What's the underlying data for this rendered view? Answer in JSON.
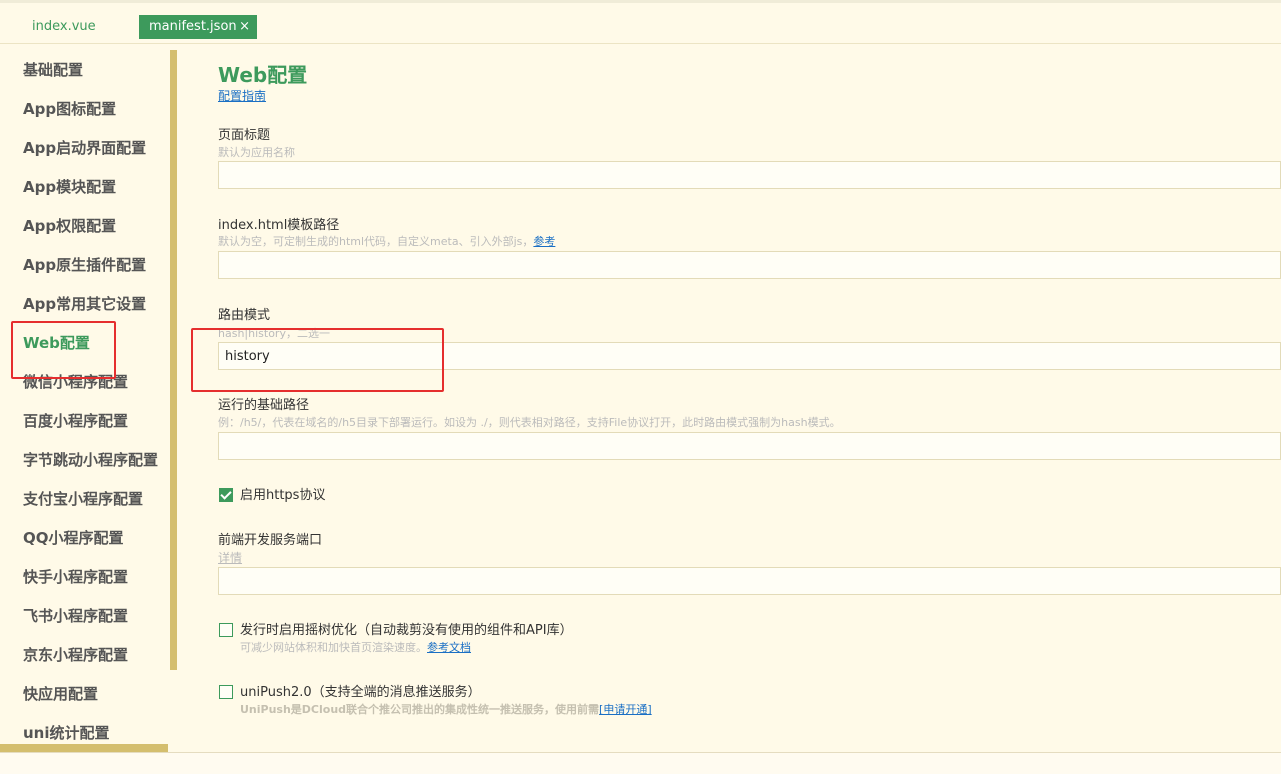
{
  "tabs": [
    {
      "label": "index.vue"
    },
    {
      "label": "manifest.json",
      "close": "×"
    }
  ],
  "sidebar": {
    "items": [
      {
        "label": "基础配置"
      },
      {
        "label": "App图标配置"
      },
      {
        "label": "App启动界面配置"
      },
      {
        "label": "App模块配置"
      },
      {
        "label": "App权限配置"
      },
      {
        "label": "App原生插件配置"
      },
      {
        "label": "App常用其它设置"
      },
      {
        "label": "Web配置"
      },
      {
        "label": "微信小程序配置"
      },
      {
        "label": "百度小程序配置"
      },
      {
        "label": "字节跳动小程序配置"
      },
      {
        "label": "支付宝小程序配置"
      },
      {
        "label": "QQ小程序配置"
      },
      {
        "label": "快手小程序配置"
      },
      {
        "label": "飞书小程序配置"
      },
      {
        "label": "京东小程序配置"
      },
      {
        "label": "快应用配置"
      },
      {
        "label": "uni统计配置"
      }
    ],
    "active_index": 7
  },
  "main": {
    "title": "Web配置",
    "guide_link": "配置指南",
    "page_title_field": {
      "label": "页面标题",
      "desc": "默认为应用名称",
      "value": ""
    },
    "template_field": {
      "label": "index.html模板路径",
      "desc": "默认为空，可定制生成的html代码，自定义meta、引入外部js，",
      "desc_link": "参考",
      "value": ""
    },
    "router_field": {
      "label": "路由模式",
      "desc": "hash|history，二选一",
      "value": "history"
    },
    "base_path_field": {
      "label": "运行的基础路径",
      "desc": "例：/h5/，代表在域名的/h5目录下部署运行。如设为 ./，则代表相对路径，支持File协议打开，此时路由模式强制为hash模式。",
      "value": ""
    },
    "https_check": {
      "label": "启用https协议",
      "checked": true
    },
    "port_field": {
      "label": "前端开发服务端口",
      "desc_link": "详情",
      "value": ""
    },
    "treeshake_check": {
      "label": "发行时启用摇树优化（自动裁剪没有使用的组件和API库）",
      "desc": "可减少网站体积和加快首页渲染速度。",
      "desc_link": "参考文档",
      "checked": false
    },
    "unipush_check": {
      "label": "uniPush2.0（支持全端的消息推送服务）",
      "desc": "UniPush是DCloud联合个推公司推出的集成性统一推送服务，使用前需",
      "desc_link": "[申请开通]",
      "checked": false
    }
  },
  "colors": {
    "accent": "#3d9a5c",
    "background": "#fffae8",
    "highlight": "#e52e2e",
    "link": "#1a6fc4"
  }
}
